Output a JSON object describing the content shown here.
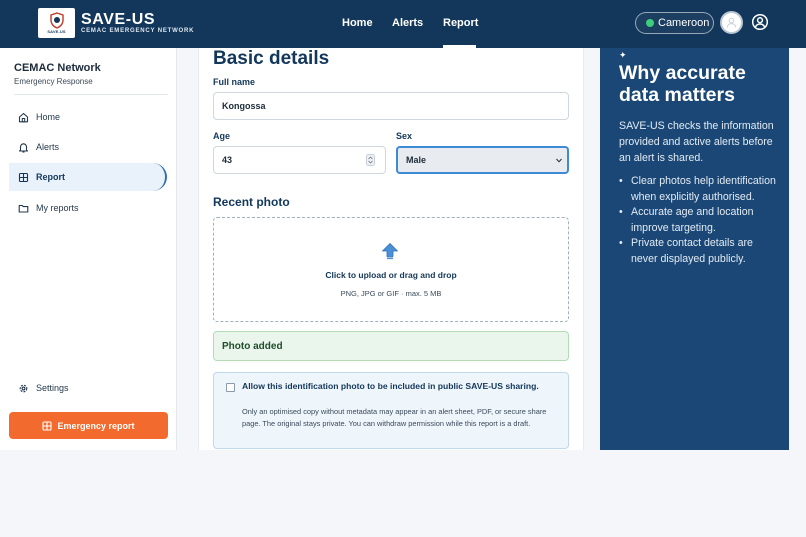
{
  "header": {
    "brand_title": "SAVE-US",
    "brand_subtitle": "CEMAC EMERGENCY NETWORK",
    "logo_text": "SAVE-US",
    "nav": [
      {
        "label": "Home"
      },
      {
        "label": "Alerts"
      },
      {
        "label": "Report",
        "active": true
      }
    ],
    "country": "Cameroon"
  },
  "sidebar": {
    "org_name": "CEMAC Network",
    "org_subtitle": "Emergency Response",
    "items": [
      {
        "label": "Home",
        "icon": "home-icon"
      },
      {
        "label": "Alerts",
        "icon": "bell-icon"
      },
      {
        "label": "Report",
        "icon": "grid-icon",
        "active": true
      },
      {
        "label": "My reports",
        "icon": "folder-icon"
      }
    ],
    "settings_label": "Settings",
    "emergency_label": "Emergency report"
  },
  "form": {
    "section_title": "Basic details",
    "full_name_label": "Full name",
    "full_name_value": "Kongossa",
    "age_label": "Age",
    "age_value": "43",
    "sex_label": "Sex",
    "sex_value": "Male",
    "photo_title": "Recent photo",
    "upload_main": "Click to upload or drag and drop",
    "upload_sub": "PNG, JPG or GIF · max. 5 MB",
    "photo_added": "Photo added",
    "consent_title": "Allow this identification photo to be included in public SAVE-US sharing.",
    "consent_body": "Only an optimised copy without metadata may appear in an alert sheet, PDF, or secure share page. The original stays private. You can withdraw permission while this report is a draft.",
    "consent_checked": false
  },
  "info": {
    "title": "Why accurate data matters",
    "paragraph": "SAVE-US checks the information provided and active alerts before an alert is shared.",
    "bullets": [
      "Clear photos help identification when explicitly authorised.",
      "Accurate age and location improve targeting.",
      "Private contact details are never displayed publicly."
    ]
  },
  "colors": {
    "header_bg": "#13375a",
    "panel_bg": "#1a4775",
    "accent_orange": "#f26a2e",
    "success_bg": "#eaf6ec",
    "status_dot": "#3ccf7a"
  }
}
